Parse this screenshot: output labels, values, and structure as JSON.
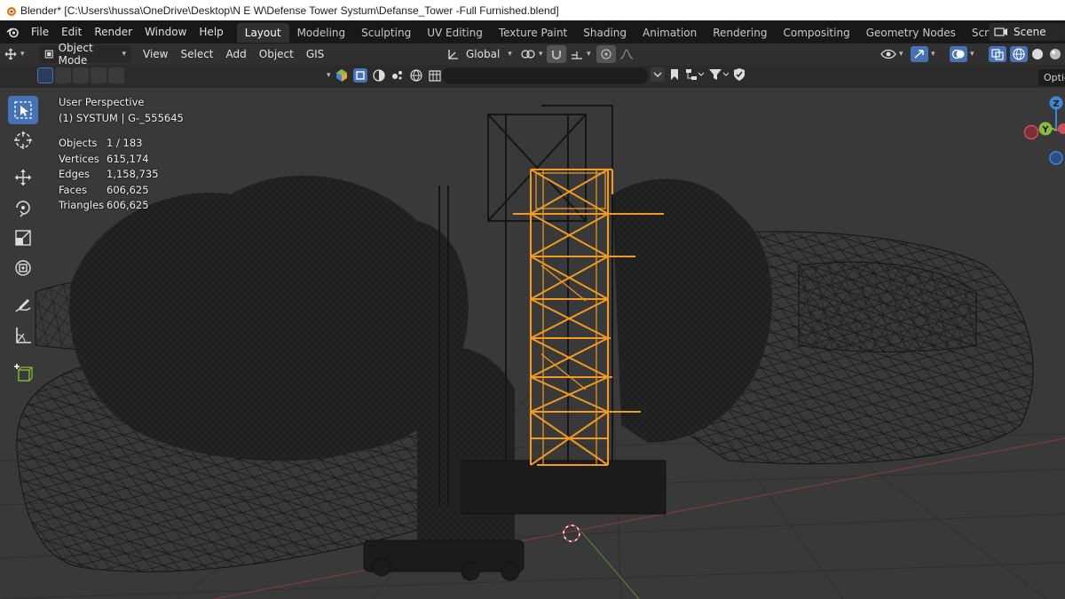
{
  "window": {
    "title": "Blender* [C:\\Users\\hussa\\OneDrive\\Desktop\\N E W\\Defense Tower Systum\\Defanse_Tower -Full Furnished.blend]"
  },
  "topbar": {
    "menus": [
      "File",
      "Edit",
      "Render",
      "Window",
      "Help"
    ],
    "workspaces": [
      "Layout",
      "Modeling",
      "Sculpting",
      "UV Editing",
      "Texture Paint",
      "Shading",
      "Animation",
      "Rendering",
      "Compositing",
      "Geometry Nodes",
      "Scripting"
    ],
    "active_workspace": "Layout",
    "add_symbol": "+",
    "scene_label": "Scene"
  },
  "header": {
    "mode": "Object Mode",
    "menus": [
      "View",
      "Select",
      "Add",
      "Object",
      "GIS"
    ],
    "orientation": "Global",
    "options_label": "Optio"
  },
  "overlay": {
    "view_name": "User Perspective",
    "collection_info": "(1) SYSTUM | G-_555645",
    "stats": [
      {
        "label": "Objects",
        "value": "1 / 183"
      },
      {
        "label": "Vertices",
        "value": "615,174"
      },
      {
        "label": "Edges",
        "value": "1,158,735"
      },
      {
        "label": "Faces",
        "value": "606,625"
      },
      {
        "label": "Triangles",
        "value": "606,625"
      }
    ]
  },
  "gizmo": {
    "z_label": "Z",
    "y_label": "Y"
  },
  "colors": {
    "selection": "#f29a21",
    "active_tool": "#4772b3",
    "viewport_bg": "#393939",
    "x_axis": "#c9515d",
    "y_axis": "#8bba3f",
    "z_axis": "#3e86d6"
  },
  "icons": [
    "blender-logo-icon",
    "scene-icon",
    "select-box-icon",
    "cursor-icon",
    "move-icon",
    "rotate-icon",
    "scale-icon",
    "transform-icon",
    "annotate-icon",
    "measure-icon",
    "add-cube-icon",
    "search-icon",
    "filter-icon",
    "snap-icon",
    "proportional-edit-icon"
  ]
}
